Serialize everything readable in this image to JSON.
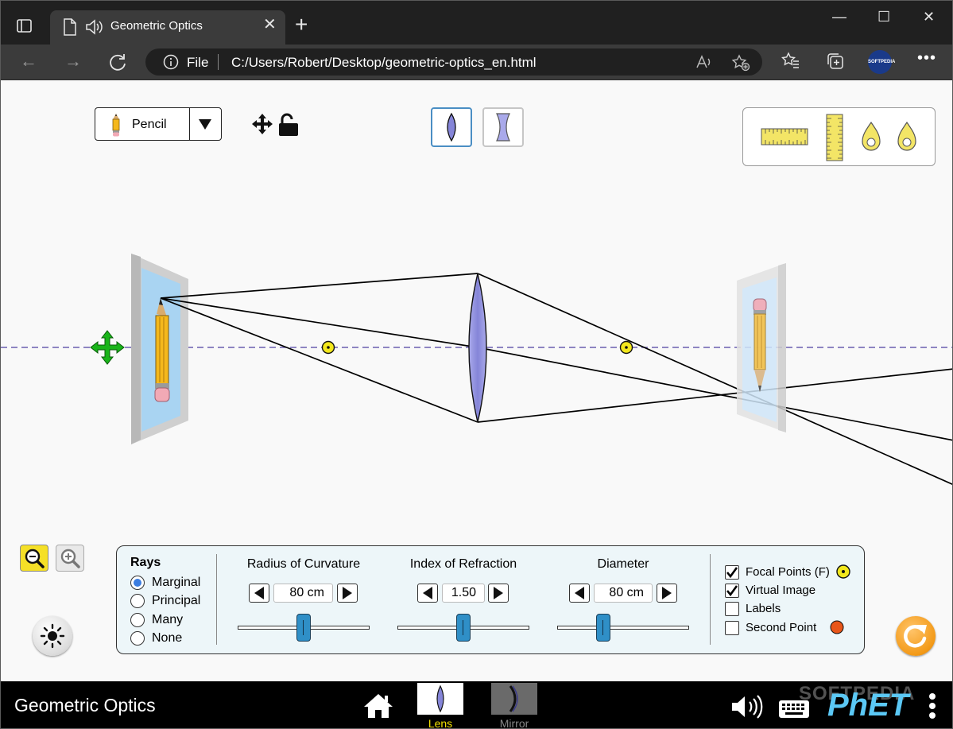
{
  "browser": {
    "tab_title": "Geometric Optics",
    "url_scheme_label": "File",
    "url": "C:/Users/Robert/Desktop/geometric-optics_en.html",
    "profile_label": "SOFTPEDIA"
  },
  "toolbar": {
    "object_selected": "Pencil",
    "lens_options": [
      "convex-lens",
      "concave-lens"
    ],
    "selected_lens": "convex-lens"
  },
  "rays": {
    "title": "Rays",
    "options": [
      "Marginal",
      "Principal",
      "Many",
      "None"
    ],
    "selected": "Marginal"
  },
  "controls": [
    {
      "label": "Radius of Curvature",
      "value": "80 cm",
      "fraction": 0.5
    },
    {
      "label": "Index of Refraction",
      "value": "1.50",
      "fraction": 0.5
    },
    {
      "label": "Diameter",
      "value": "80 cm",
      "fraction": 0.35
    }
  ],
  "checkboxes": [
    {
      "label": "Focal Points (F)",
      "checked": true
    },
    {
      "label": "Virtual Image",
      "checked": true
    },
    {
      "label": "Labels",
      "checked": false
    },
    {
      "label": "Second Point",
      "checked": false
    }
  ],
  "navbar": {
    "title": "Geometric Optics",
    "screens": [
      "Lens",
      "Mirror"
    ],
    "active_screen": "Lens",
    "brand": "PhET",
    "watermark": "SOFTPEDIA"
  },
  "colors": {
    "lens_fill": "#8f8fde",
    "focal_point": "#f3e81c",
    "second_point": "#e8561a",
    "optical_axis": "#6b5fb0",
    "slider_thumb": "#2f8fc7",
    "active_screen_label": "#f2e100"
  }
}
